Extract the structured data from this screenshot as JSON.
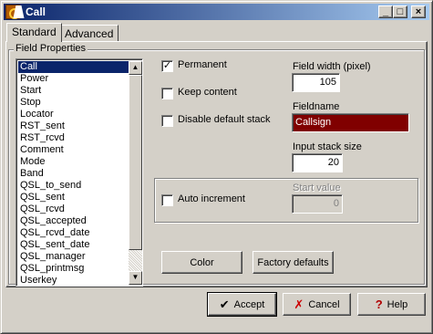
{
  "window": {
    "title": "Call",
    "buttons": {
      "minimize": "_",
      "maximize": "□",
      "close": "×"
    }
  },
  "tabs": [
    {
      "label": "Standard",
      "active": true
    },
    {
      "label": "Advanced",
      "active": false
    }
  ],
  "field_properties": {
    "legend": "Field Properties",
    "list": {
      "items": [
        "Call",
        "Power",
        "Start",
        "Stop",
        "Locator",
        "RST_sent",
        "RST_rcvd",
        "Comment",
        "Mode",
        "Band",
        "QSL_to_send",
        "QSL_sent",
        "QSL_rcvd",
        "QSL_accepted",
        "QSL_rcvd_date",
        "QSL_sent_date",
        "QSL_manager",
        "QSL_printmsg",
        "Userkey"
      ],
      "selected": "Call"
    },
    "permanent": {
      "label": "Permanent",
      "checked": true
    },
    "keep_content": {
      "label": "Keep content",
      "checked": false
    },
    "disable_default_stack": {
      "label": "Disable default stack",
      "checked": false
    },
    "field_width": {
      "label": "Field width (pixel)",
      "value": "105"
    },
    "fieldname": {
      "label": "Fieldname",
      "value": "Callsign"
    },
    "input_stack_size": {
      "label": "Input stack size",
      "value": "20"
    },
    "auto_increment": {
      "label": "Auto increment",
      "checked": false
    },
    "start_value": {
      "label": "Start value",
      "value": "0"
    },
    "color_button": "Color",
    "factory_defaults_button": "Factory defaults"
  },
  "dialog_buttons": {
    "accept": "Accept",
    "cancel": "Cancel",
    "help": "Help"
  },
  "colors": {
    "titlebar_start": "#0a246a",
    "titlebar_end": "#a6caf0",
    "fieldname_bg": "#800000",
    "selection": "#0a246a",
    "accept_icon": "#000000",
    "cancel_icon": "#cc0000",
    "help_icon": "#b00000"
  }
}
